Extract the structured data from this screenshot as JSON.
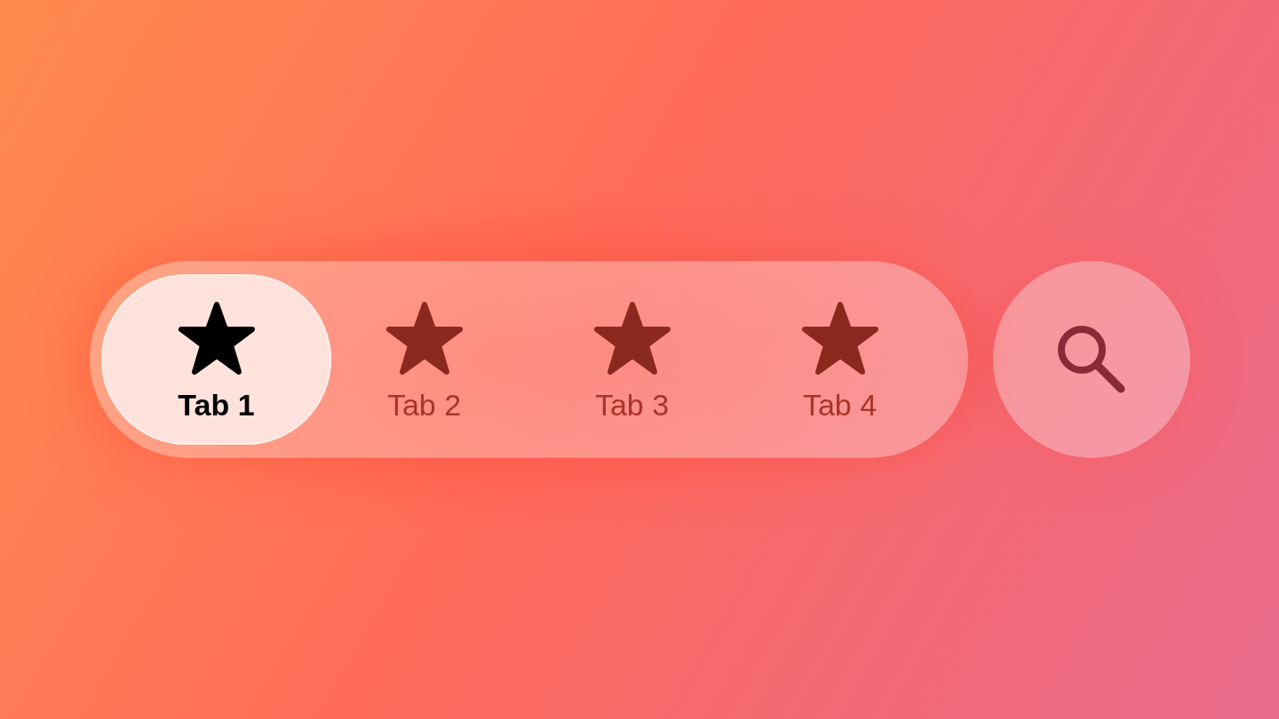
{
  "tabs": [
    {
      "label": "Tab 1",
      "selected": true
    },
    {
      "label": "Tab 2",
      "selected": false
    },
    {
      "label": "Tab 3",
      "selected": false
    },
    {
      "label": "Tab 4",
      "selected": false
    }
  ]
}
